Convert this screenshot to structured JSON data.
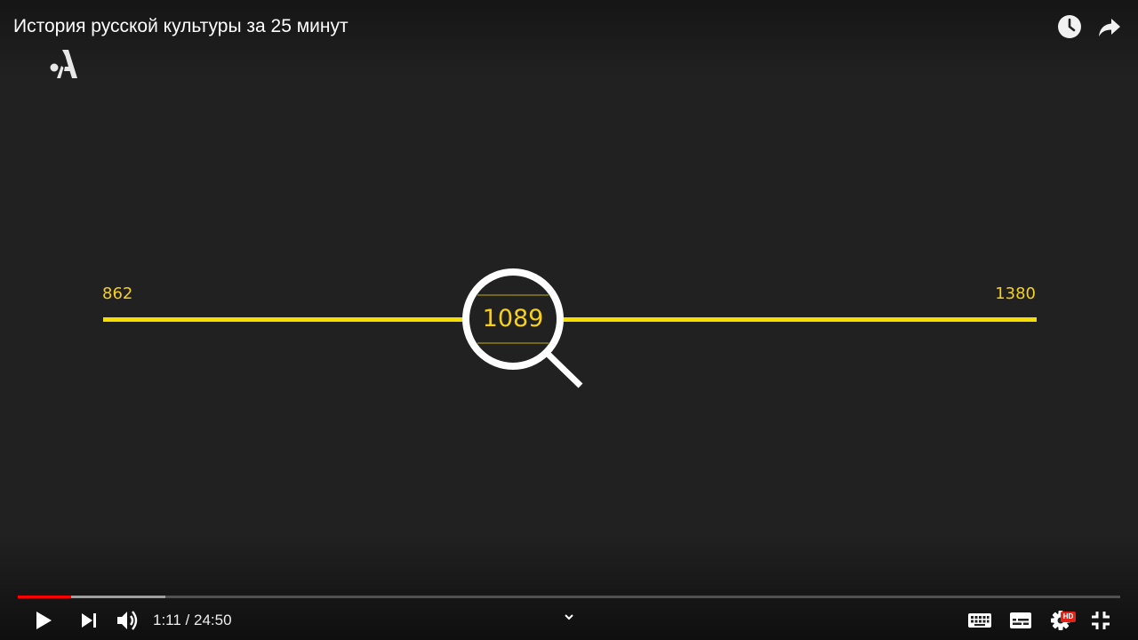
{
  "video": {
    "title": "История русской культуры за 25 минут"
  },
  "top_icons": {
    "watch_later": "clock-icon",
    "share": "share-arrow-icon"
  },
  "logo": {
    "symbol": "A",
    "icon": "channel-logo"
  },
  "timeline": {
    "start_year": "862",
    "end_year": "1380",
    "current_year": "1089",
    "color": "#f5de00"
  },
  "progress": {
    "played_fraction": 0.048,
    "loaded_fraction": 0.134,
    "played_color": "#ff0000"
  },
  "controls": {
    "time_display": "1:11 / 24:50",
    "settings_badge": "HD",
    "icons": [
      "play-icon",
      "next-icon",
      "volume-icon",
      "chevron-down-icon",
      "keyboard-icon",
      "subtitles-icon",
      "settings-icon",
      "exit-fullscreen-icon"
    ]
  }
}
